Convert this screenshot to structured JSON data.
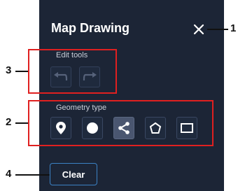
{
  "panel": {
    "title": "Map Drawing",
    "close_icon": "close-icon"
  },
  "edit_tools": {
    "label": "Edit tools",
    "buttons": [
      {
        "icon": "undo-icon"
      },
      {
        "icon": "redo-icon"
      }
    ]
  },
  "geometry": {
    "label": "Geometry type",
    "buttons": [
      {
        "icon": "map-pin-icon"
      },
      {
        "icon": "circle-icon"
      },
      {
        "icon": "polyline-icon",
        "active": true
      },
      {
        "icon": "polygon-icon"
      },
      {
        "icon": "rectangle-icon"
      }
    ]
  },
  "clear_label": "Clear",
  "callouts": [
    "1",
    "2",
    "3",
    "4"
  ],
  "colors": {
    "panel_bg": "#1c2536",
    "highlight": "#e02020",
    "clear_border": "#3b82c4"
  }
}
